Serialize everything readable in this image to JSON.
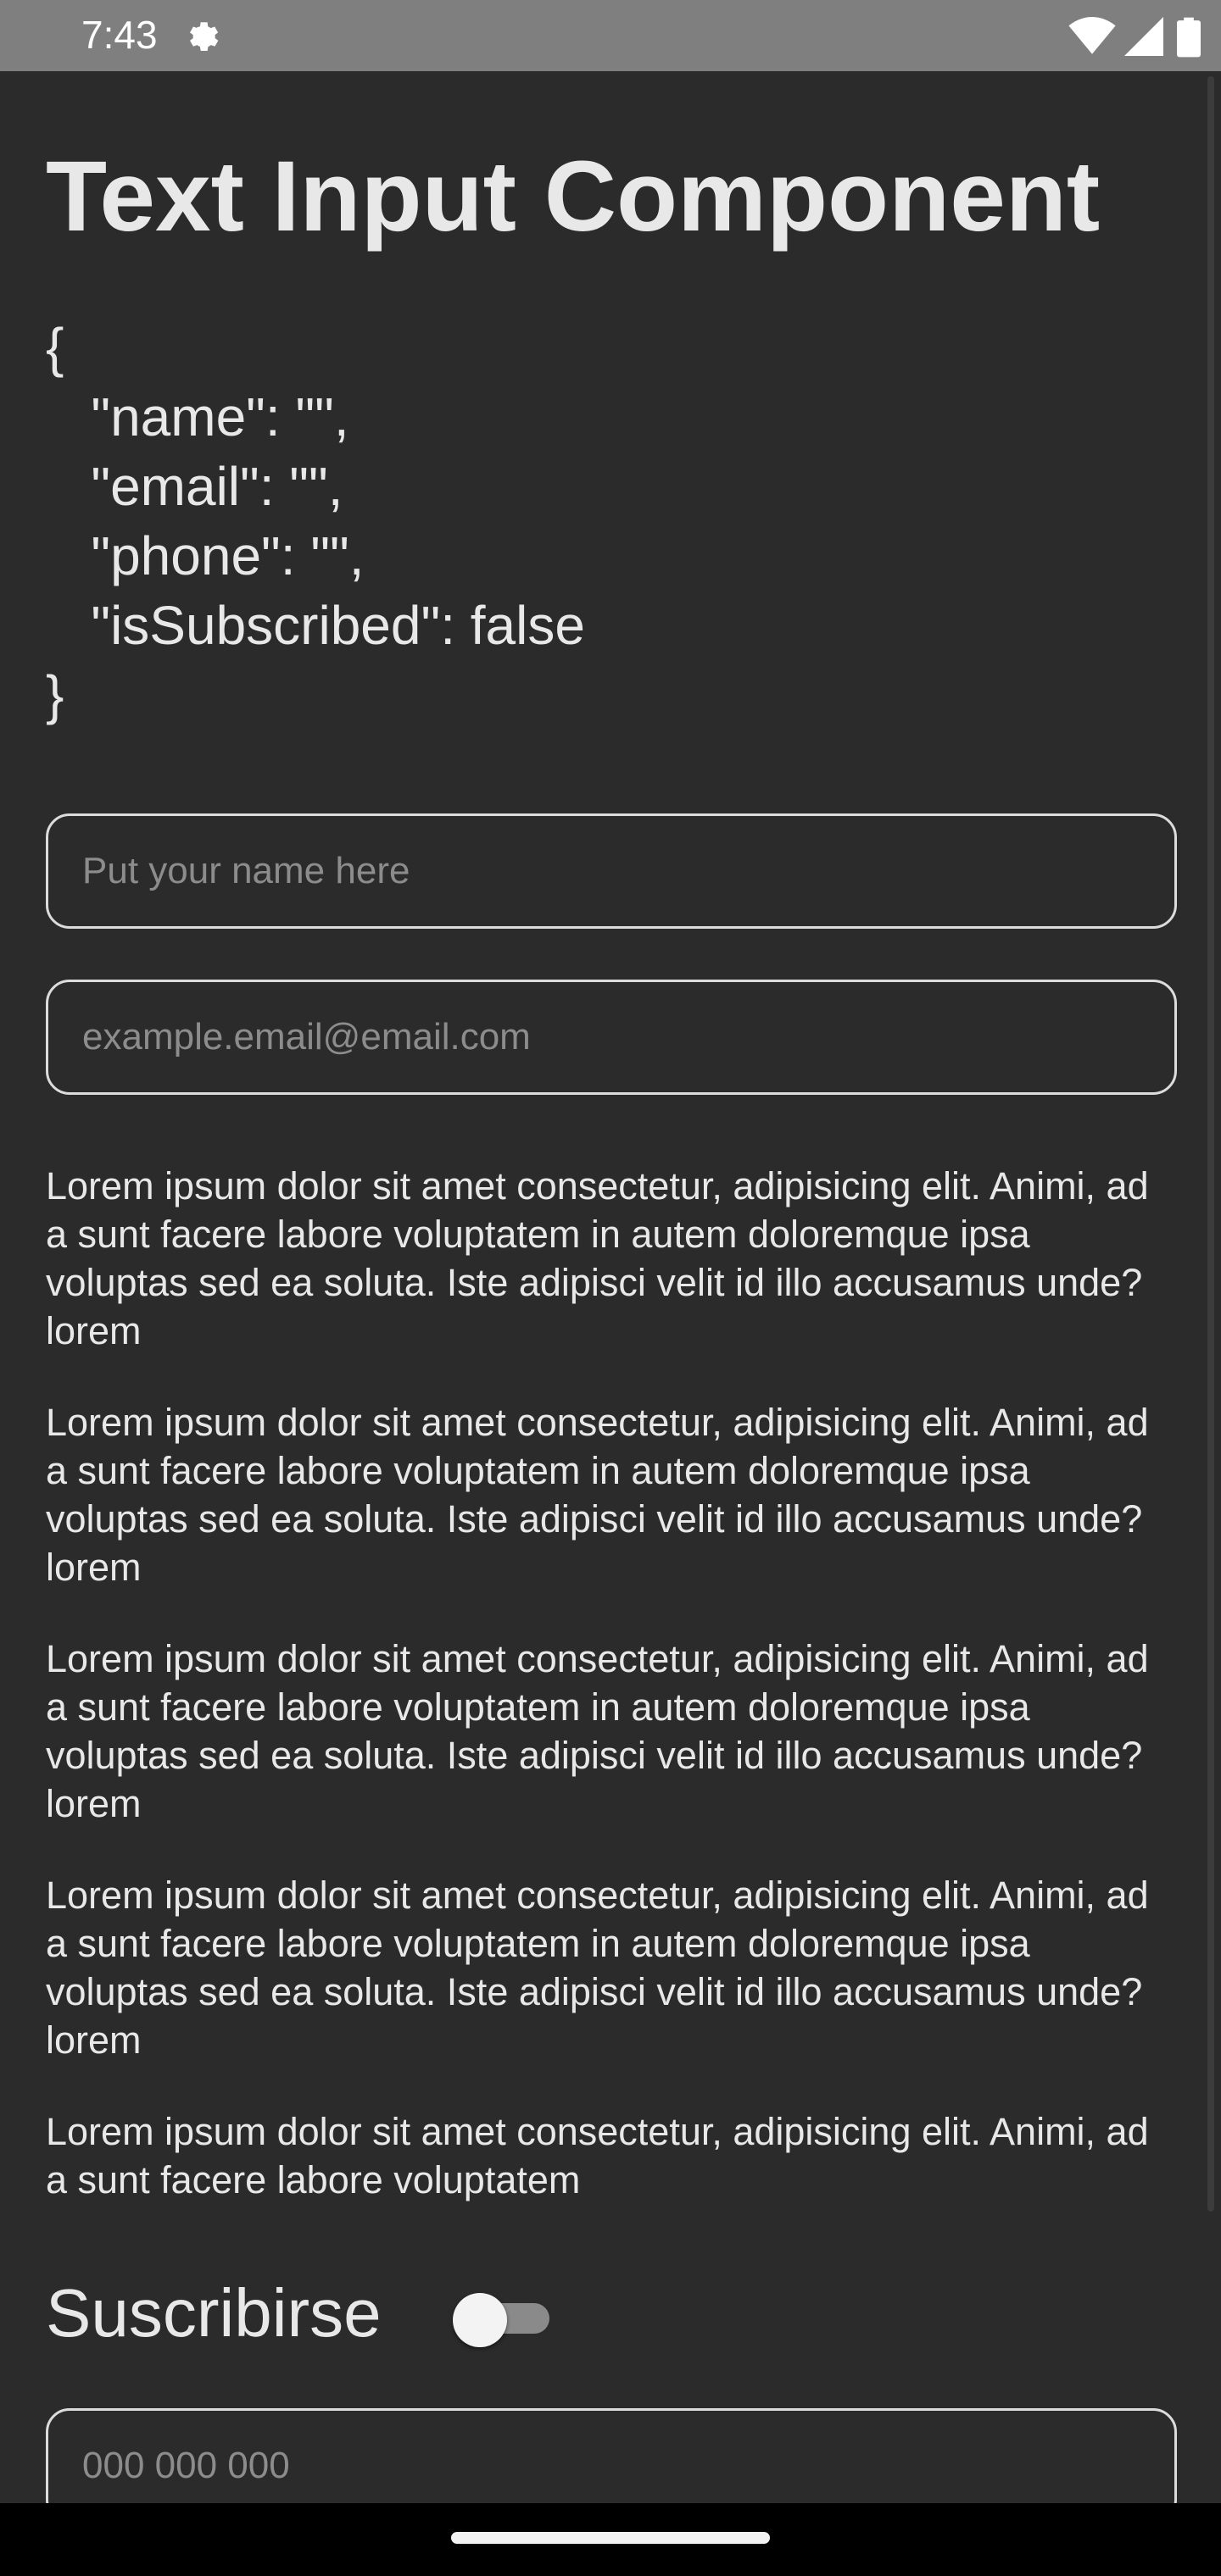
{
  "status_bar": {
    "time": "7:43",
    "icons": [
      "settings-gear-icon",
      "wifi-icon",
      "cell-signal-icon",
      "battery-icon"
    ]
  },
  "page": {
    "title": "Text Input Component",
    "json_preview": "{\n   \"name\": \"\",\n   \"email\": \"\",\n   \"phone\": \"\",\n   \"isSubscribed\": false\n}"
  },
  "form": {
    "name_input": {
      "value": "",
      "placeholder": "Put your name here"
    },
    "email_input": {
      "value": "",
      "placeholder": "example.email@email.com"
    },
    "phone_input": {
      "value": "",
      "placeholder": "000 000 000"
    },
    "subscribe": {
      "label": "Suscribirse",
      "checked": false
    }
  },
  "paragraphs": [
    "Lorem ipsum dolor sit amet consectetur, adipisicing elit. Animi, ad a sunt facere labore voluptatem in autem doloremque ipsa voluptas sed ea soluta. Iste adipisci velit id illo accusamus unde? lorem",
    "Lorem ipsum dolor sit amet consectetur, adipisicing elit. Animi, ad a sunt facere labore voluptatem in autem doloremque ipsa voluptas sed ea soluta. Iste adipisci velit id illo accusamus unde? lorem",
    "Lorem ipsum dolor sit amet consectetur, adipisicing elit. Animi, ad a sunt facere labore voluptatem in autem doloremque ipsa voluptas sed ea soluta. Iste adipisci velit id illo accusamus unde? lorem",
    "Lorem ipsum dolor sit amet consectetur, adipisicing elit. Animi, ad a sunt facere labore voluptatem in autem doloremque ipsa voluptas sed ea soluta. Iste adipisci velit id illo accusamus unde? lorem",
    "Lorem ipsum dolor sit amet consectetur, adipisicing elit. Animi, ad a sunt facere labore voluptatem"
  ],
  "colors": {
    "background": "#2b2b2b",
    "status_bar": "#7f7f7f",
    "text": "#e8e8e8",
    "placeholder": "#8c8c8c",
    "input_border": "#dcdcdc",
    "nav_bar": "#000000"
  }
}
